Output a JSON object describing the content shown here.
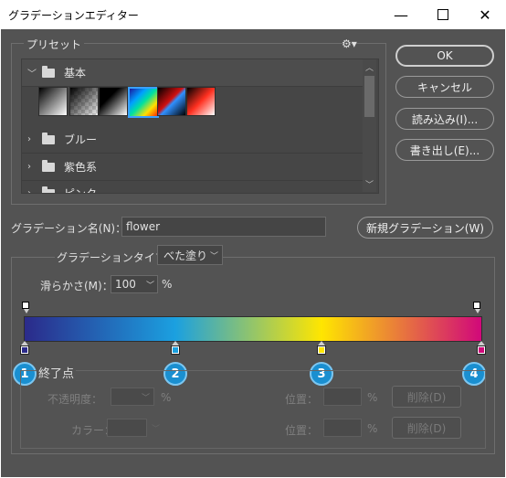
{
  "window": {
    "title": "グラデーションエディター"
  },
  "presets": {
    "legend": "プリセット",
    "groups": [
      {
        "label": "基本",
        "expanded": true
      },
      {
        "label": "ブルー",
        "expanded": false
      },
      {
        "label": "紫色系",
        "expanded": false
      },
      {
        "label": "ピンク",
        "expanded": false
      }
    ]
  },
  "buttons": {
    "ok": "OK",
    "cancel": "キャンセル",
    "load": "読み込み(I)...",
    "save": "書き出し(E)...",
    "new": "新規グラデーション(W)"
  },
  "name_field": {
    "label": "グラデーション名(N)：",
    "value": "flower"
  },
  "type_field": {
    "label": "グラデーションタイプ：",
    "value": "べた塗り"
  },
  "smooth_field": {
    "label": "滑らかさ(M)：",
    "value": "100",
    "unit": "%"
  },
  "stops_section": {
    "legend": "終了点",
    "opacity_label": "不透明度：",
    "opacity_unit": "%",
    "location_label": "位置：",
    "location_unit": "%",
    "delete_label": "削除(D)",
    "color_label": "カラー："
  },
  "color_stops": [
    {
      "badge": "1",
      "color": "#2b2a8a",
      "location": 0
    },
    {
      "badge": "2",
      "color": "#1ba0e0",
      "location": 33
    },
    {
      "badge": "3",
      "color": "#ffe600",
      "location": 65
    },
    {
      "badge": "4",
      "color": "#d1087a",
      "location": 100
    }
  ]
}
